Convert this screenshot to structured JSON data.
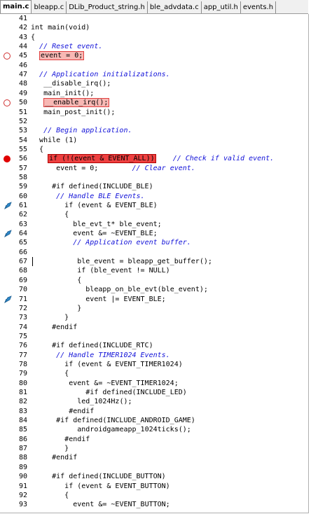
{
  "tabs": [
    {
      "label": "main.c",
      "active": true
    },
    {
      "label": "bleapp.c",
      "active": false
    },
    {
      "label": "DLib_Product_string.h",
      "active": false
    },
    {
      "label": "ble_advdata.c",
      "active": false
    },
    {
      "label": "app_util.h",
      "active": false
    },
    {
      "label": "events.h",
      "active": false
    }
  ],
  "colors": {
    "comment": "#1010d8",
    "breakpoint": "#e00000",
    "highlight": "#f8b8b4",
    "bookmark": "#2070b0"
  },
  "lines": [
    {
      "n": "41",
      "t": ""
    },
    {
      "n": "42",
      "t": "int main(void)"
    },
    {
      "n": "43",
      "t": "{"
    },
    {
      "n": "44",
      "t": "  // Reset event.",
      "c": 1
    },
    {
      "n": "45",
      "t": "  event = 0;",
      "m": "bp-hollow",
      "h": "fill"
    },
    {
      "n": "46",
      "t": ""
    },
    {
      "n": "47",
      "t": "  // Application initializations.",
      "c": 1
    },
    {
      "n": "48",
      "t": "   __disable_irq();"
    },
    {
      "n": "49",
      "t": "   main_init();"
    },
    {
      "n": "50",
      "t": "   __enable_irq();",
      "m": "bp-hollow",
      "h": "fill"
    },
    {
      "n": "51",
      "t": "   main_post_init();"
    },
    {
      "n": "52",
      "t": ""
    },
    {
      "n": "53",
      "t": "   // Begin application.",
      "c": 1
    },
    {
      "n": "54",
      "t": "  while (1)"
    },
    {
      "n": "55",
      "t": "  {"
    },
    {
      "n": "56",
      "t": "    if (!(event & EVENT_ALL))",
      "tail": "    // Check if valid event.",
      "m": "bp-solid",
      "h": "red"
    },
    {
      "n": "57",
      "t": "      event = 0;",
      "tail": "        // Clear event."
    },
    {
      "n": "58",
      "t": ""
    },
    {
      "n": "59",
      "t": "     #if defined(INCLUDE_BLE)"
    },
    {
      "n": "60",
      "t": "      // Handle BLE Events.",
      "c": 1
    },
    {
      "n": "61",
      "t": "        if (event & EVENT_BLE)",
      "m": "bookmark"
    },
    {
      "n": "62",
      "t": "        {"
    },
    {
      "n": "63",
      "t": "          ble_evt_t* ble_event;"
    },
    {
      "n": "64",
      "t": "          event &= ~EVENT_BLE;",
      "m": "bookmark"
    },
    {
      "n": "65",
      "t": "          // Application event buffer.",
      "c": 1
    },
    {
      "n": "66",
      "t": ""
    },
    {
      "n": "67",
      "t": "           ble_event = bleapp_get_buffer();",
      "caret": 1
    },
    {
      "n": "68",
      "t": "           if (ble_event != NULL)"
    },
    {
      "n": "69",
      "t": "           {"
    },
    {
      "n": "70",
      "t": "             bleapp_on_ble_evt(ble_event);"
    },
    {
      "n": "71",
      "t": "             event |= EVENT_BLE;",
      "m": "bookmark"
    },
    {
      "n": "72",
      "t": "           }"
    },
    {
      "n": "73",
      "t": "        }"
    },
    {
      "n": "74",
      "t": "     #endif"
    },
    {
      "n": "75",
      "t": ""
    },
    {
      "n": "76",
      "t": "     #if defined(INCLUDE_RTC)"
    },
    {
      "n": "77",
      "t": "      // Handle TIMER1024 Events.",
      "c": 1
    },
    {
      "n": "78",
      "t": "        if (event & EVENT_TIMER1024)"
    },
    {
      "n": "79",
      "t": "        {"
    },
    {
      "n": "80",
      "t": "         event &= ~EVENT_TIMER1024;"
    },
    {
      "n": "81",
      "t": "             #if defined(INCLUDE_LED)"
    },
    {
      "n": "82",
      "t": "           led_1024Hz();"
    },
    {
      "n": "83",
      "t": "         #endif"
    },
    {
      "n": "84",
      "t": "      #if defined(INCLUDE_ANDROID_GAME)"
    },
    {
      "n": "85",
      "t": "           androidgameapp_1024ticks();"
    },
    {
      "n": "86",
      "t": "        #endif"
    },
    {
      "n": "87",
      "t": "        }"
    },
    {
      "n": "88",
      "t": "     #endif"
    },
    {
      "n": "89",
      "t": ""
    },
    {
      "n": "90",
      "t": "     #if defined(INCLUDE_BUTTON)"
    },
    {
      "n": "91",
      "t": "        if (event & EVENT_BUTTON)"
    },
    {
      "n": "92",
      "t": "        {"
    },
    {
      "n": "93",
      "t": "          event &= ~EVENT_BUTTON;"
    }
  ]
}
